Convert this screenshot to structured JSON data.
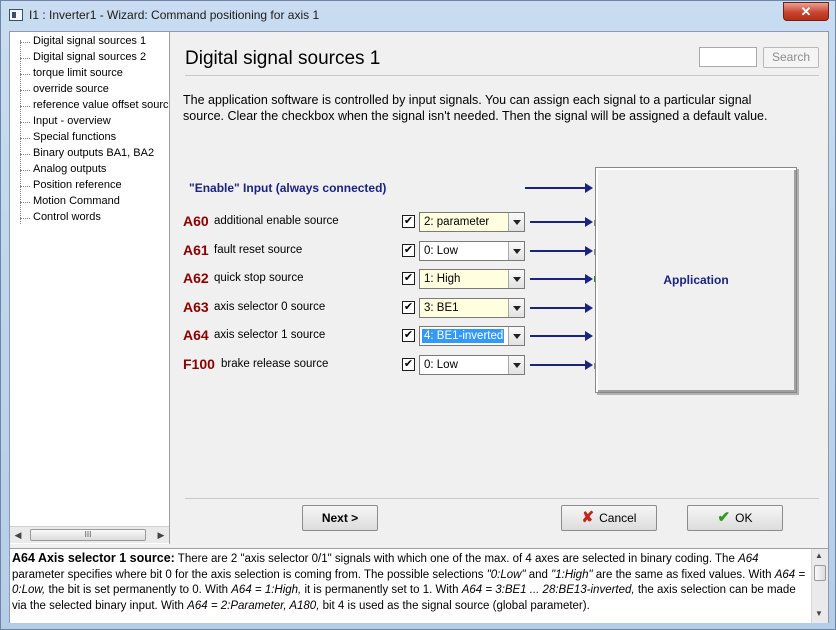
{
  "window": {
    "title": "I1 : Inverter1 - Wizard: Command positioning for axis 1",
    "close_label": "✕"
  },
  "tree": {
    "items": [
      "Digital signal sources 1",
      "Digital signal sources 2",
      "torque limit source",
      "override source",
      "reference value offset source",
      "Input - overview",
      "Special functions",
      "Binary outputs BA1, BA2",
      "Analog outputs",
      "Position reference",
      "Motion Command",
      "Control words"
    ],
    "scroll_thumb": "III"
  },
  "main": {
    "title": "Digital signal sources 1",
    "search_placeholder": "",
    "search_label": "Search",
    "description": "The application software is controlled by input signals. You can assign each signal to a particular signal source. Clear the checkbox when the signal isn't needed. Then the signal will be assigned a default value.",
    "enable_label": "\"Enable\" Input (always connected)",
    "application_label": "Application",
    "signals": [
      {
        "code": "A60",
        "name": "additional enable source",
        "checked": "✔",
        "value": "2:  parameter",
        "style": "yellow",
        "pin": "inactive"
      },
      {
        "code": "A61",
        "name": "fault reset source",
        "checked": "✔",
        "value": "0:  Low",
        "style": "white",
        "pin": "inactive"
      },
      {
        "code": "A62",
        "name": "quick stop source",
        "checked": "✔",
        "value": "1:  High",
        "style": "yellow",
        "pin": "active"
      },
      {
        "code": "A63",
        "name": "axis selector 0 source",
        "checked": "✔",
        "value": "3:  BE1",
        "style": "yellow",
        "pin": "none"
      },
      {
        "code": "A64",
        "name": "axis selector 1 source",
        "checked": "✔",
        "value": "4:  BE1-inverted",
        "style": "selected",
        "pin": "none"
      },
      {
        "code": "F100",
        "name": "brake release source",
        "checked": "✔",
        "value": "0:  Low",
        "style": "white",
        "pin": "inactive"
      }
    ],
    "next_label": "Next >",
    "cancel_label": "Cancel",
    "ok_label": "OK"
  },
  "help": {
    "title": "A64  Axis selector 1 source:",
    "s1": " There are 2 \"axis selector 0/1\" signals with which one of the max. of 4 axes are selected in binary coding. The ",
    "e1": "A64",
    "s2": " parameter specifies where bit 0 for the axis selection is coming from. The possible selections ",
    "e2": "\"0:Low\"",
    "s3": " and ",
    "e3": "\"1:High\"",
    "s4": " are the same as fixed values. With ",
    "e4": "A64 = 0:Low,",
    "s5": " the bit is set permanently to 0. With ",
    "e5": "A64 = 1:High,",
    "s6": " it is permanently set to 1. With ",
    "e6": "A64 = 3:BE1 ... 28:BE13-inverted,",
    "s7": " the axis selection can be made via the selected binary input. With ",
    "e7": "A64 = 2:Parameter, A180,",
    "s8": " bit 4 is used as the signal source (global parameter)."
  },
  "colors": {
    "signal_code": "#8b0000",
    "arrow": "#1a237e",
    "combo_yellow": "#ffffe0",
    "selection": "#3399ff",
    "active_pin": "#22cc22"
  }
}
